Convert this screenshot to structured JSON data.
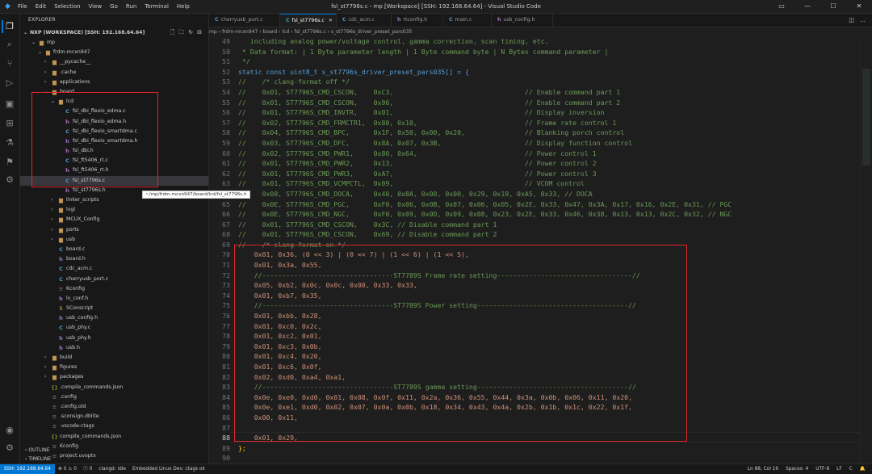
{
  "window": {
    "title": "fsl_st7796s.c - mp [Workspace] [SSH: 192.168.64.64] - Visual Studio Code",
    "menu": [
      "File",
      "Edit",
      "Selection",
      "View",
      "Go",
      "Run",
      "Terminal",
      "Help"
    ]
  },
  "sidebar": {
    "header": "EXPLORER",
    "workspace": "NXP (WORKSPACE) [SSH: 192.168.64.64]",
    "tree": [
      {
        "label": "mp",
        "depth": 1,
        "kind": "folder",
        "open": true
      },
      {
        "label": "frdm-mcxn947",
        "depth": 2,
        "kind": "folder",
        "open": true
      },
      {
        "label": "__pycache__",
        "depth": 3,
        "kind": "folder",
        "open": false
      },
      {
        "label": ".cache",
        "depth": 3,
        "kind": "folder",
        "open": false
      },
      {
        "label": "applications",
        "depth": 3,
        "kind": "folder",
        "open": false
      },
      {
        "label": "board",
        "depth": 3,
        "kind": "folder",
        "open": true
      },
      {
        "label": "lcd",
        "depth": 4,
        "kind": "folder",
        "open": true
      },
      {
        "label": "fsl_dbi_flexio_edma.c",
        "depth": 5,
        "kind": "c"
      },
      {
        "label": "fsl_dbi_flexio_edma.h",
        "depth": 5,
        "kind": "h"
      },
      {
        "label": "fsl_dbi_flexio_smartdma.c",
        "depth": 5,
        "kind": "c"
      },
      {
        "label": "fsl_dbi_flexio_smartdma.h",
        "depth": 5,
        "kind": "h"
      },
      {
        "label": "fsl_dbi.h",
        "depth": 5,
        "kind": "h"
      },
      {
        "label": "fsl_ft5406_rt.c",
        "depth": 5,
        "kind": "c"
      },
      {
        "label": "fsl_ft5406_rt.h",
        "depth": 5,
        "kind": "h"
      },
      {
        "label": "fsl_st7796s.c",
        "depth": 5,
        "kind": "c",
        "selected": true
      },
      {
        "label": "fsl_st7796s.h",
        "depth": 5,
        "kind": "h"
      },
      {
        "label": "linker_scripts",
        "depth": 4,
        "kind": "folder",
        "open": false
      },
      {
        "label": "lvgl",
        "depth": 4,
        "kind": "folder",
        "open": false
      },
      {
        "label": "MCUX_Config",
        "depth": 4,
        "kind": "folder",
        "open": false
      },
      {
        "label": "ports",
        "depth": 4,
        "kind": "folder",
        "open": false
      },
      {
        "label": "usb",
        "depth": 4,
        "kind": "folder",
        "open": false
      },
      {
        "label": "board.c",
        "depth": 4,
        "kind": "c"
      },
      {
        "label": "board.h",
        "depth": 4,
        "kind": "h"
      },
      {
        "label": "cdc_acm.c",
        "depth": 4,
        "kind": "c"
      },
      {
        "label": "cherryusb_port.c",
        "depth": 4,
        "kind": "c"
      },
      {
        "label": "Kconfig",
        "depth": 4,
        "kind": "file"
      },
      {
        "label": "lv_conf.h",
        "depth": 4,
        "kind": "h"
      },
      {
        "label": "SConscript",
        "depth": 4,
        "kind": "py"
      },
      {
        "label": "usb_config.h",
        "depth": 4,
        "kind": "h"
      },
      {
        "label": "usb_phy.c",
        "depth": 4,
        "kind": "c"
      },
      {
        "label": "usb_phy.h",
        "depth": 4,
        "kind": "h"
      },
      {
        "label": "usb.h",
        "depth": 4,
        "kind": "h"
      },
      {
        "label": "build",
        "depth": 3,
        "kind": "folder",
        "open": false
      },
      {
        "label": "figures",
        "depth": 3,
        "kind": "folder",
        "open": false
      },
      {
        "label": "packages",
        "depth": 3,
        "kind": "folder",
        "open": false
      },
      {
        "label": ".compile_commands.json",
        "depth": 3,
        "kind": "json"
      },
      {
        "label": ".config",
        "depth": 3,
        "kind": "file"
      },
      {
        "label": ".config.old",
        "depth": 3,
        "kind": "file"
      },
      {
        "label": ".sconsign.dblite",
        "depth": 3,
        "kind": "file"
      },
      {
        "label": ".vscode-ctags",
        "depth": 3,
        "kind": "file"
      },
      {
        "label": "compile_commands.json",
        "depth": 3,
        "kind": "json"
      },
      {
        "label": "Kconfig",
        "depth": 3,
        "kind": "file"
      },
      {
        "label": "project.uvoptx",
        "depth": 3,
        "kind": "file"
      }
    ],
    "outline": "OUTLINE",
    "timeline": "TIMELINE",
    "tooltip": "~/mp/frdm-mcxn947/board/lcd/fsl_st7796s.h"
  },
  "tabs": [
    {
      "label": "cherryusb_port.c",
      "kind": "c"
    },
    {
      "label": "fsl_st7796s.c",
      "kind": "c",
      "active": true
    },
    {
      "label": "cdc_acm.c",
      "kind": "c"
    },
    {
      "label": "rtconfig.h",
      "kind": "h"
    },
    {
      "label": "main.c",
      "kind": "c"
    },
    {
      "label": "usb_config.h",
      "kind": "h"
    }
  ],
  "breadcrumb": [
    "mp",
    "frdm-mcxn947",
    "board",
    "lcd",
    "fsl_st7796s.c",
    "s_st7796s_driver_preset_pars035"
  ],
  "editor": {
    "lines": [
      {
        "n": "49",
        "cls": "cmt",
        "t": "   including analog power/voltage control, gamma correction, scan timing, etc."
      },
      {
        "n": "50",
        "cls": "cmt",
        "t": " * Data format: | 1 Byte parameter length | 1 Byte command byte | N Bytes command parameter |"
      },
      {
        "n": "51",
        "cls": "cmt",
        "t": " */"
      },
      {
        "n": "52",
        "cls": "kw",
        "t": "static const uint8_t s_st7796s_driver_preset_pars035[] = {"
      },
      {
        "n": "53",
        "cls": "cmt",
        "t": "//    /* clang-format off */"
      },
      {
        "n": "54",
        "cls": "cmt",
        "t": "//    0x01, ST7796S_CMD_CSCON,    0xC3,                                 // Enable command part 1"
      },
      {
        "n": "55",
        "cls": "cmt",
        "t": "//    0x01, ST7796S_CMD_CSCON,    0x96,                                 // Enable command part 2"
      },
      {
        "n": "56",
        "cls": "cmt",
        "t": "//    0x01, ST7796S_CMD_INVTR,    0x01,                                 // Display inversion"
      },
      {
        "n": "57",
        "cls": "cmt",
        "t": "//    0x02, ST7796S_CMD_FRMCTR1,  0x80, 0x10,                           // Frame rate control 1"
      },
      {
        "n": "58",
        "cls": "cmt",
        "t": "//    0x04, ST7796S_CMD_BPC,      0x1F, 0x50, 0x00, 0x20,               // Blanking porch control"
      },
      {
        "n": "59",
        "cls": "cmt",
        "t": "//    0x03, ST7796S_CMD_DFC,      0x8A, 0x07, 0x3B,                     // Display function control"
      },
      {
        "n": "60",
        "cls": "cmt",
        "t": "//    0x02, ST7796S_CMD_PWR1,     0x80, 0x64,                           // Power control 1"
      },
      {
        "n": "61",
        "cls": "cmt",
        "t": "//    0x01, ST7796S_CMD_PWR2,     0x13,                                 // Power control 2"
      },
      {
        "n": "62",
        "cls": "cmt",
        "t": "//    0x01, ST7796S_CMD_PWR3,     0xA7,                                 // Power control 3"
      },
      {
        "n": "63",
        "cls": "cmt",
        "t": "//    0x01, ST7796S_CMD_VCMPCTL,  0x09,                                 // VCOM control"
      },
      {
        "n": "64",
        "cls": "cmt",
        "t": "//    0x08, ST7796S_CMD_DOCA,     0x40, 0x8A, 0x00, 0x00, 0x29, 0x19, 0xA5, 0x33, // DOCA"
      },
      {
        "n": "65",
        "cls": "cmt",
        "t": "//    0x0E, ST7796S_CMD_PGC,      0xF0, 0x06, 0x0B, 0x07, 0x06, 0x05, 0x2E, 0x33, 0x47, 0x3A, 0x17, 0x16, 0x2E, 0x31, // PGC"
      },
      {
        "n": "66",
        "cls": "cmt",
        "t": "//    0x0E, ST7796S_CMD_NGC,      0xF0, 0x09, 0x0D, 0x09, 0x08, 0x23, 0x2E, 0x33, 0x46, 0x38, 0x13, 0x13, 0x2C, 0x32, // NGC"
      },
      {
        "n": "67",
        "cls": "cmt",
        "t": "//    0x01, ST7796S_CMD_CSCON,    0x3C, // Disable command part 1"
      },
      {
        "n": "68",
        "cls": "cmt",
        "t": "//    0x01, ST7796S_CMD_CSCON,    0x69, // Disable command part 2"
      },
      {
        "n": "69",
        "cls": "cmt",
        "t": "//    /* clang-format on */"
      },
      {
        "n": "70",
        "cls": "hex",
        "t": "    0x01, 0x36, (0 << 3) | (0 << 7) | (1 << 6) | (1 << 5),"
      },
      {
        "n": "71",
        "cls": "hex",
        "t": "    0x01, 0x3a, 0x55,"
      },
      {
        "n": "72",
        "cls": "cmtb",
        "t": "    //---------------------------------ST7789S Frame rate setting----------------------------------//"
      },
      {
        "n": "73",
        "cls": "hex",
        "t": "    0x05, 0xb2, 0x0c, 0x0c, 0x00, 0x33, 0x33,"
      },
      {
        "n": "74",
        "cls": "hex",
        "t": "    0x01, 0xb7, 0x35,"
      },
      {
        "n": "75",
        "cls": "cmtb",
        "t": "    //---------------------------------ST7789S Power setting--------------------------------------//"
      },
      {
        "n": "76",
        "cls": "hex",
        "t": "    0x01, 0xbb, 0x28,"
      },
      {
        "n": "77",
        "cls": "hex",
        "t": "    0x01, 0xc0, 0x2c,"
      },
      {
        "n": "78",
        "cls": "hex",
        "t": "    0x01, 0xc2, 0x01,"
      },
      {
        "n": "79",
        "cls": "hex",
        "t": "    0x01, 0xc3, 0x0b,"
      },
      {
        "n": "80",
        "cls": "hex",
        "t": "    0x01, 0xc4, 0x20,"
      },
      {
        "n": "81",
        "cls": "hex",
        "t": "    0x01, 0xc6, 0x0f,"
      },
      {
        "n": "82",
        "cls": "hex",
        "t": "    0x02, 0xd0, 0xa4, 0xa1,"
      },
      {
        "n": "83",
        "cls": "cmtb",
        "t": "    //---------------------------------ST7789S gamma setting--------------------------------------//"
      },
      {
        "n": "84",
        "cls": "hex",
        "t": "    0x0e, 0xe0, 0xd0, 0x01, 0x08, 0x0f, 0x11, 0x2a, 0x36, 0x55, 0x44, 0x3a, 0x0b, 0x06, 0x11, 0x20,"
      },
      {
        "n": "85",
        "cls": "hex",
        "t": "    0x0e, 0xe1, 0xd0, 0x02, 0x07, 0x0a, 0x0b, 0x18, 0x34, 0x43, 0x4a, 0x2b, 0x1b, 0x1c, 0x22, 0x1f,"
      },
      {
        "n": "86",
        "cls": "hex",
        "t": "    0x00, 0x11,"
      },
      {
        "n": "87",
        "cls": "hex",
        "t": ""
      },
      {
        "n": "88",
        "cls": "hex",
        "t": "    0x01, 0x29,",
        "current": true
      },
      {
        "n": "89",
        "cls": "brk",
        "t": "};"
      },
      {
        "n": "90",
        "cls": "dim",
        "t": ""
      },
      {
        "n": "91",
        "cls": "dim",
        "t": ""
      }
    ]
  },
  "statusbar": {
    "remote": "SSH: 192.168.64.64",
    "left": [
      "⊗ 0  ⚠ 0",
      "ⓘ 0",
      "clangd: idle",
      "Embedded Linux Dev: ctags ok"
    ],
    "right": [
      "Ln 88, Col 16",
      "Spaces: 4",
      "UTF-8",
      "LF",
      "C",
      "🔔"
    ]
  },
  "colors": {
    "accent": "#0078d4",
    "highlight_box": "#e0242d",
    "comment": "#6a9955",
    "string_hex": "#ce9178",
    "keyword": "#569cd6"
  }
}
